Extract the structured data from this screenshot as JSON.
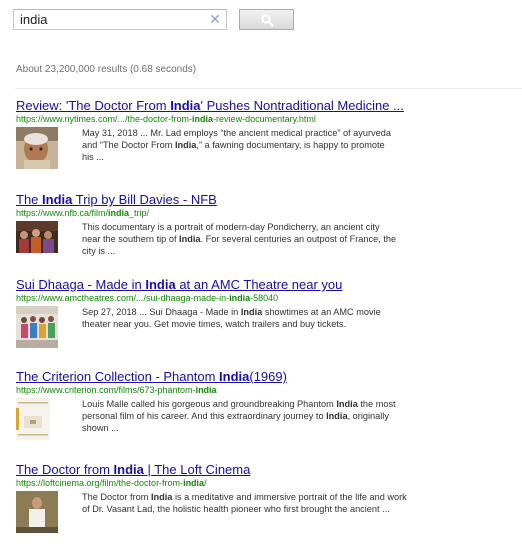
{
  "search": {
    "query": "india",
    "clear_glyph": "✕",
    "button_icon": "search-icon"
  },
  "stats": "About 23,200,000 results (0.68 seconds)",
  "results": [
    {
      "title_pre": "Review: 'The Doctor From ",
      "title_bold": "India",
      "title_post": "' Pushes Nontraditional Medicine ...",
      "url_pre": "https://www.nytimes.com/.../the-doctor-from-",
      "url_bold": "india",
      "url_post": "-review-documentary.html",
      "snippet_html": "May 31, 2018 ... Mr. Lad employs “the ancient medical practice” of ayurveda<br>and “The Doctor From <b>India</b>,” a fawning documentary, is happy to promote<br>his ..."
    },
    {
      "title_pre": "The ",
      "title_bold": "India",
      "title_post": " Trip by Bill Davies - NFB",
      "url_pre": "https://www.nfb.ca/film/",
      "url_bold": "india",
      "url_post": "_trip/",
      "snippet_html": "This documentary is a portrait of modern-day Pondicherry, an ancient city<br>near the southern tip of <b>India</b>. For several centuries an outpost of France, the<br>city is ..."
    },
    {
      "title_pre": "Sui Dhaaga - Made in ",
      "title_bold": "India",
      "title_post": " at an AMC Theatre near you",
      "url_pre": "https://www.amctheatres.com/.../sui-dhaaga-made-in-",
      "url_bold": "india",
      "url_post": "-58040",
      "snippet_html": "Sep 27, 2018 ... Sui Dhaaga - Made in <b>India</b> showtimes at an AMC movie<br>theater near you. Get movie times, watch trailers and buy tickets."
    },
    {
      "title_pre": "The Criterion Collection - Phantom ",
      "title_bold": "India",
      "title_post": "(1969)",
      "url_pre": "https://www.criterion.com/films/673-phantom-",
      "url_bold": "india",
      "url_post": "",
      "snippet_html": "Louis Malle called his gorgeous and groundbreaking Phantom <b>India</b> the most<br>personal film of his career. And this extraordinary journey to <b>India</b>, originally<br>shown ..."
    },
    {
      "title_pre": "The Doctor from ",
      "title_bold": "India",
      "title_post": " | The Loft Cinema",
      "url_pre": "https://loftcinema.org/film/the-doctor-from-",
      "url_bold": "india",
      "url_post": "/",
      "snippet_html": "The Doctor from <b>India</b> is a meditative and immersive portrait of the life and work<br>of Dr. Vasant Lad, the holistic health pioneer who first brought the ancient ..."
    }
  ],
  "colors": {
    "link": "#1a0dab",
    "url": "#138a07",
    "clear_icon": "#8aa4d6"
  }
}
